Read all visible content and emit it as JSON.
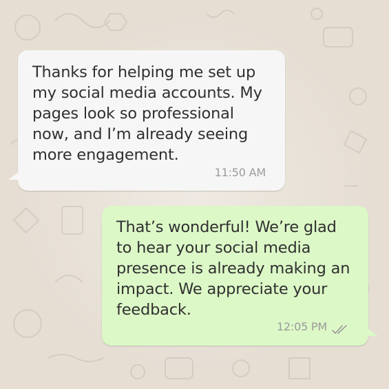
{
  "messages": [
    {
      "direction": "incoming",
      "text": "Thanks for helping me set up my social media accounts. My pages look so professional now, and I’m already seeing more engagement.",
      "time": "11:50 AM"
    },
    {
      "direction": "outgoing",
      "text": "That’s wonderful! We’re glad to hear your social media presence is already making an impact. We appreciate your feedback.",
      "time": "12:05 PM",
      "status_icon": "double-check-icon"
    }
  ],
  "colors": {
    "chat_background": "#e6ded3",
    "incoming_bubble": "#f6f6f6",
    "outgoing_bubble": "#dcf8c7",
    "text": "#303030",
    "timestamp": "#9a9a9a"
  }
}
